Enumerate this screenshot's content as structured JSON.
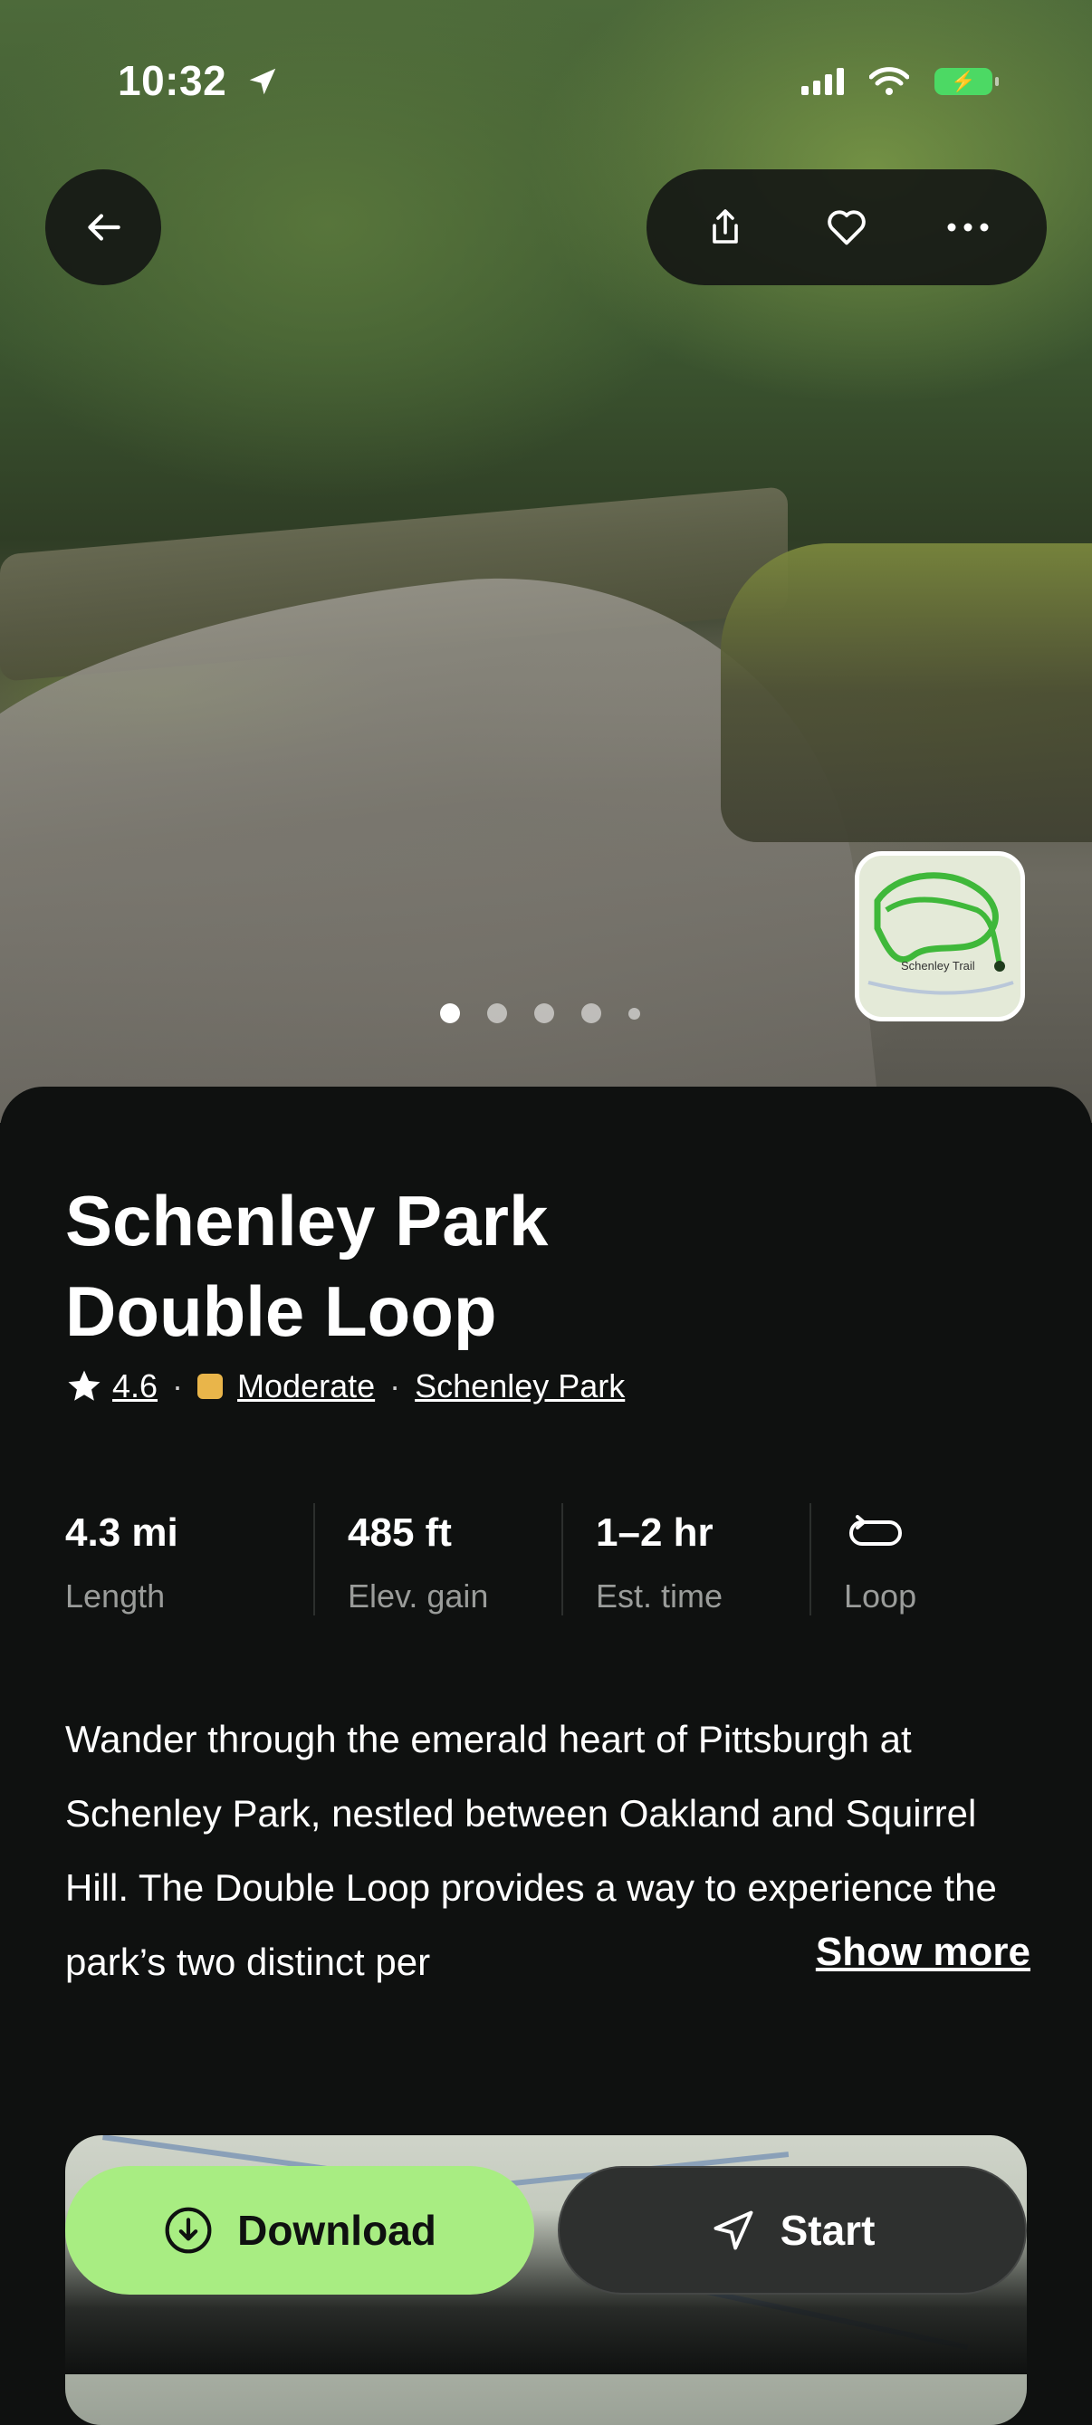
{
  "status_bar": {
    "time": "10:32"
  },
  "hero": {
    "map_thumb_label": "Schenley Trail"
  },
  "trail": {
    "title": "Schenley Park\nDouble Loop",
    "rating": "4.6",
    "difficulty": "Moderate",
    "difficulty_color": "#e9b54a",
    "park": "Schenley Park"
  },
  "stats": [
    {
      "value": "4.3 mi",
      "label": "Length"
    },
    {
      "value": "485 ft",
      "label": "Elev. gain"
    },
    {
      "value": "1–2 hr",
      "label": "Est. time"
    },
    {
      "value": "",
      "label": "Loop",
      "icon": "loop-icon"
    }
  ],
  "description": "Wander through the emerald heart of Pittsburgh at Schenley Park, nestled between Oakland and Squirrel Hill. The Double Loop provides a way to experience the park’s two distinct per",
  "show_more": "Show more",
  "actions": {
    "download": "Download",
    "start": "Start"
  },
  "colors": {
    "accent_green": "#a8ed82",
    "background": "#0f1110"
  }
}
